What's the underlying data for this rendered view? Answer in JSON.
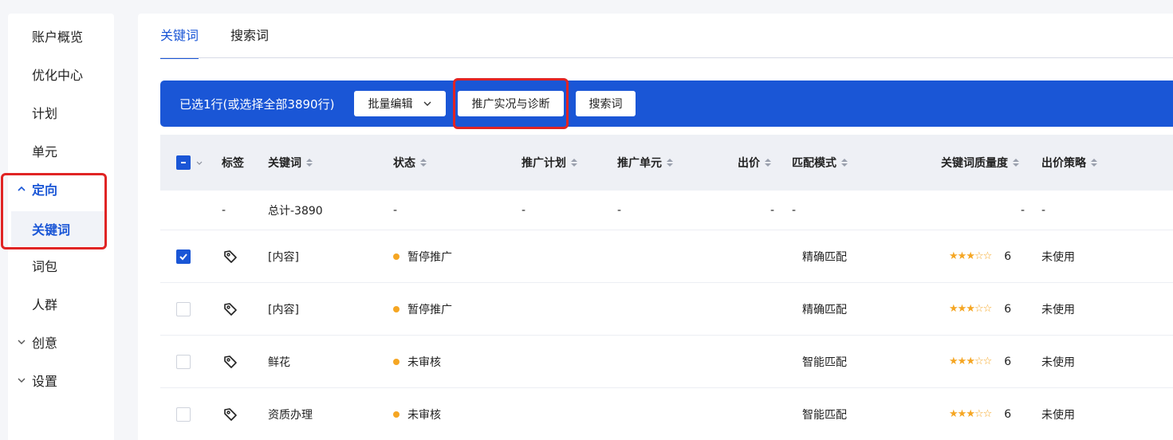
{
  "sidebar": {
    "items": [
      {
        "label": "账户概览"
      },
      {
        "label": "优化中心"
      },
      {
        "label": "计划"
      },
      {
        "label": "单元"
      },
      {
        "label": "定向"
      },
      {
        "label": "关键词"
      },
      {
        "label": "词包"
      },
      {
        "label": "人群"
      },
      {
        "label": "创意"
      },
      {
        "label": "设置"
      }
    ]
  },
  "tabs": [
    {
      "label": "关键词"
    },
    {
      "label": "搜索词"
    }
  ],
  "bulk_bar": {
    "selection_text": "已选1行(或选择全部3890行)",
    "batch_edit_label": "批量编辑",
    "diagnose_label": "推广实况与诊断",
    "search_terms_label": "搜索词"
  },
  "table": {
    "headers": {
      "tag": "标签",
      "keyword": "关键词",
      "status": "状态",
      "plan": "推广计划",
      "unit": "推广单元",
      "bid": "出价",
      "match": "匹配模式",
      "quality": "关键词质量度",
      "strategy": "出价策略"
    },
    "summary": {
      "tag": "-",
      "keyword": "总计-3890",
      "status": "-",
      "plan": "-",
      "unit": "-",
      "bid": "-",
      "match": "-",
      "quality": "-",
      "strategy": "-"
    },
    "rows": [
      {
        "checked": true,
        "keyword": "[内容]",
        "status": "暂停推广",
        "match": "精确匹配",
        "stars": 3,
        "score": "6",
        "strategy": "未使用"
      },
      {
        "checked": false,
        "keyword": "[内容]",
        "status": "暂停推广",
        "match": "精确匹配",
        "stars": 3,
        "score": "6",
        "strategy": "未使用"
      },
      {
        "checked": false,
        "keyword": "鲜花",
        "status": "未审核",
        "match": "智能匹配",
        "stars": 3,
        "score": "6",
        "strategy": "未使用"
      },
      {
        "checked": false,
        "keyword": "资质办理",
        "status": "未审核",
        "match": "智能匹配",
        "stars": 3,
        "score": "6",
        "strategy": "未使用"
      }
    ]
  },
  "colors": {
    "brand": "#1a56d6",
    "highlight": "#e02424",
    "status_dot": "#f5a623",
    "star": "#f5a623"
  }
}
